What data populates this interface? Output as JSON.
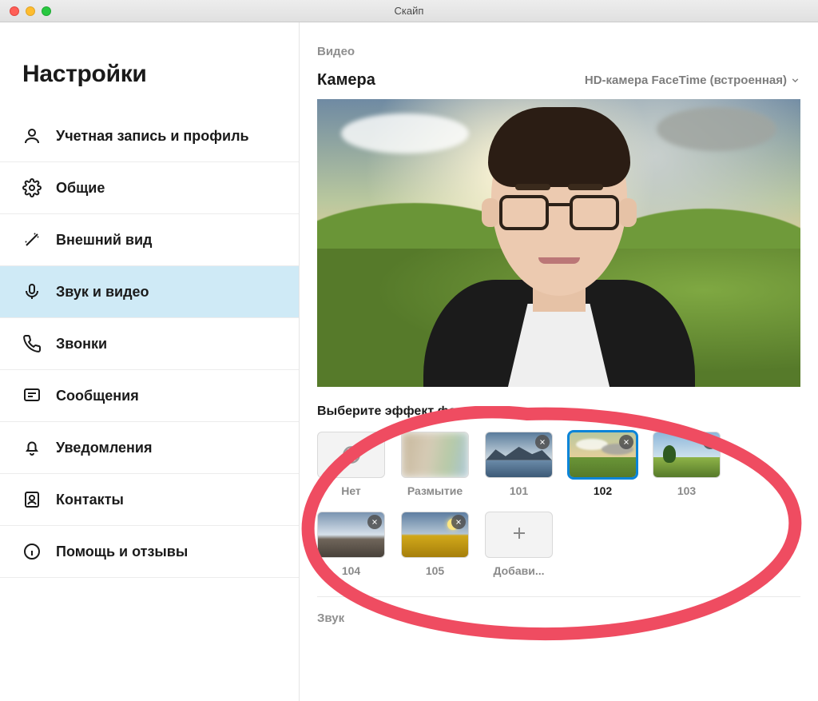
{
  "window": {
    "title": "Скайп"
  },
  "sidebar": {
    "title": "Настройки",
    "items": [
      {
        "label": "Учетная запись и профиль"
      },
      {
        "label": "Общие"
      },
      {
        "label": "Внешний вид"
      },
      {
        "label": "Звук и видео"
      },
      {
        "label": "Звонки"
      },
      {
        "label": "Сообщения"
      },
      {
        "label": "Уведомления"
      },
      {
        "label": "Контакты"
      },
      {
        "label": "Помощь и отзывы"
      }
    ],
    "selected_index": 3
  },
  "video": {
    "section_label": "Видео",
    "camera_label": "Камера",
    "camera_selected": "HD-камера FaceTime (встроенная)",
    "bg_effects_heading": "Выберите эффект фона",
    "backgrounds": {
      "selected_index": 3,
      "items": [
        {
          "label": "Нет",
          "kind": "none",
          "removable": false
        },
        {
          "label": "Размытие",
          "kind": "blur",
          "removable": false
        },
        {
          "label": "101",
          "kind": "lake",
          "removable": true
        },
        {
          "label": "102",
          "kind": "field",
          "removable": true
        },
        {
          "label": "103",
          "kind": "green",
          "removable": true
        },
        {
          "label": "104",
          "kind": "rock",
          "removable": true
        },
        {
          "label": "105",
          "kind": "flower",
          "removable": true
        },
        {
          "label": "Добави...",
          "kind": "add",
          "removable": false
        }
      ]
    }
  },
  "audio": {
    "section_label": "Звук"
  }
}
